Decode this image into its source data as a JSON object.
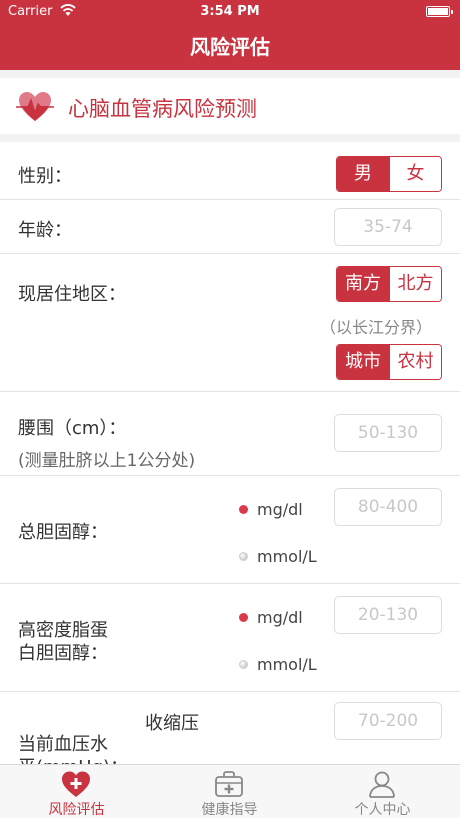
{
  "status": {
    "carrier": "Carrier",
    "time": "3:54 PM"
  },
  "nav": {
    "title": "风险评估"
  },
  "header": {
    "title": "心脑血管病风险预测"
  },
  "gender": {
    "label": "性别：",
    "options": [
      "男",
      "女"
    ],
    "selected": "男"
  },
  "age": {
    "label": "年龄：",
    "placeholder": "35-74"
  },
  "region": {
    "label": "现居住地区：",
    "direction_options": [
      "南方",
      "北方"
    ],
    "direction_selected": "南方",
    "hint": "（以长江分界）",
    "area_options": [
      "城市",
      "农村"
    ],
    "area_selected": "城市"
  },
  "waist": {
    "label": "腰围（cm）：",
    "sublabel": "(测量肚脐以上1公分处)",
    "placeholder": "50-130"
  },
  "cholesterol": {
    "label": "总胆固醇：",
    "unit_1": "mg/dl",
    "unit_2": "mmol/L",
    "placeholder": "80-400",
    "selected_unit": "mg/dl"
  },
  "hdl": {
    "label_line1": "高密度脂蛋",
    "label_line2": "白胆固醇：",
    "unit_1": "mg/dl",
    "unit_2": "mmol/L",
    "placeholder": "20-130",
    "selected_unit": "mg/dl"
  },
  "bp": {
    "label_line1": "当前血压水",
    "label_line2": "平(mmHg)：",
    "systolic_label": "收缩压",
    "placeholder": "70-200"
  },
  "tabs": [
    {
      "label": "风险评估",
      "icon": "heart-plus-icon",
      "active": true
    },
    {
      "label": "健康指导",
      "icon": "medical-kit-icon",
      "active": false
    },
    {
      "label": "个人中心",
      "icon": "user-icon",
      "active": false
    }
  ],
  "colors": {
    "accent": "#c9323f",
    "background": "#f2f2f2"
  }
}
